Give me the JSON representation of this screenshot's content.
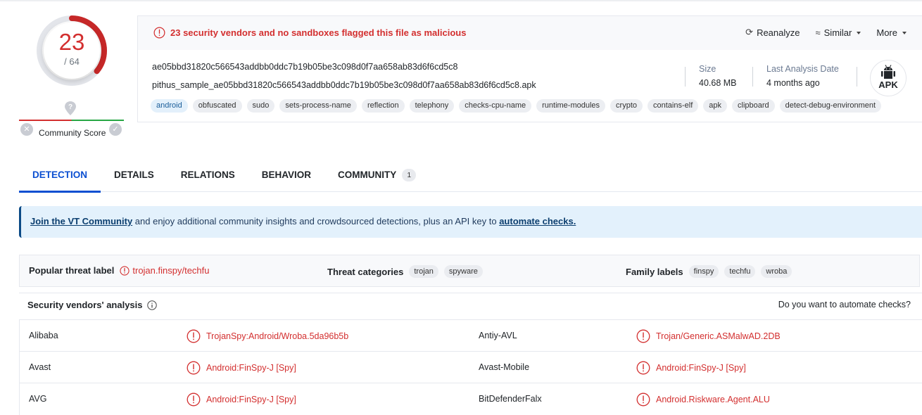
{
  "score": {
    "detections": "23",
    "total": "/ 64",
    "detection_fraction": 0.359,
    "community_score_label": "Community Score",
    "colors": {
      "malicious": "#d32f2f",
      "harmless": "#28a745"
    }
  },
  "file_card": {
    "alert_text": "23 security vendors and no sandboxes flagged this file as malicious",
    "actions": {
      "reanalyze": "Reanalyze",
      "similar": "Similar",
      "more": "More"
    },
    "hash": "ae05bbd31820c566543addbb0ddc7b19b05be3c098d0f7aa658ab83d6f6cd5c8",
    "filename": "pithus_sample_ae05bbd31820c566543addbb0ddc7b19b05be3c098d0f7aa658ab83d6f6cd5c8.apk",
    "tags": [
      "android",
      "obfuscated",
      "sudo",
      "sets-process-name",
      "reflection",
      "telephony",
      "checks-cpu-name",
      "runtime-modules",
      "crypto",
      "contains-elf",
      "apk",
      "clipboard",
      "detect-debug-environment"
    ],
    "size_label": "Size",
    "size_value": "40.68 MB",
    "date_label": "Last Analysis Date",
    "date_value": "4 months ago",
    "file_type": "APK"
  },
  "tabs": [
    {
      "label": "DETECTION",
      "active": true
    },
    {
      "label": "DETAILS"
    },
    {
      "label": "RELATIONS"
    },
    {
      "label": "BEHAVIOR"
    },
    {
      "label": "COMMUNITY",
      "badge": "1"
    }
  ],
  "banner": {
    "link1": "Join the VT Community",
    "text": " and enjoy additional community insights and crowdsourced detections, plus an API key to ",
    "link2": "automate checks."
  },
  "threat": {
    "popular_label": "Popular threat label",
    "popular_value": "trojan.finspy/techfu",
    "categories_label": "Threat categories",
    "categories": [
      "trojan",
      "spyware"
    ],
    "family_label": "Family labels",
    "families": [
      "finspy",
      "techfu",
      "wroba"
    ]
  },
  "vendors": {
    "title": "Security vendors' analysis",
    "automate": "Do you want to automate checks?",
    "rows": [
      {
        "left_name": "Alibaba",
        "left_result": "TrojanSpy:Android/Wroba.5da96b5b",
        "right_name": "Antiy-AVL",
        "right_result": "Trojan/Generic.ASMalwAD.2DB"
      },
      {
        "left_name": "Avast",
        "left_result": "Android:FinSpy-J [Spy]",
        "right_name": "Avast-Mobile",
        "right_result": "Android:FinSpy-J [Spy]"
      },
      {
        "left_name": "AVG",
        "left_result": "Android:FinSpy-J [Spy]",
        "right_name": "BitDefenderFalx",
        "right_result": "Android.Riskware.Agent.ALU"
      }
    ]
  }
}
